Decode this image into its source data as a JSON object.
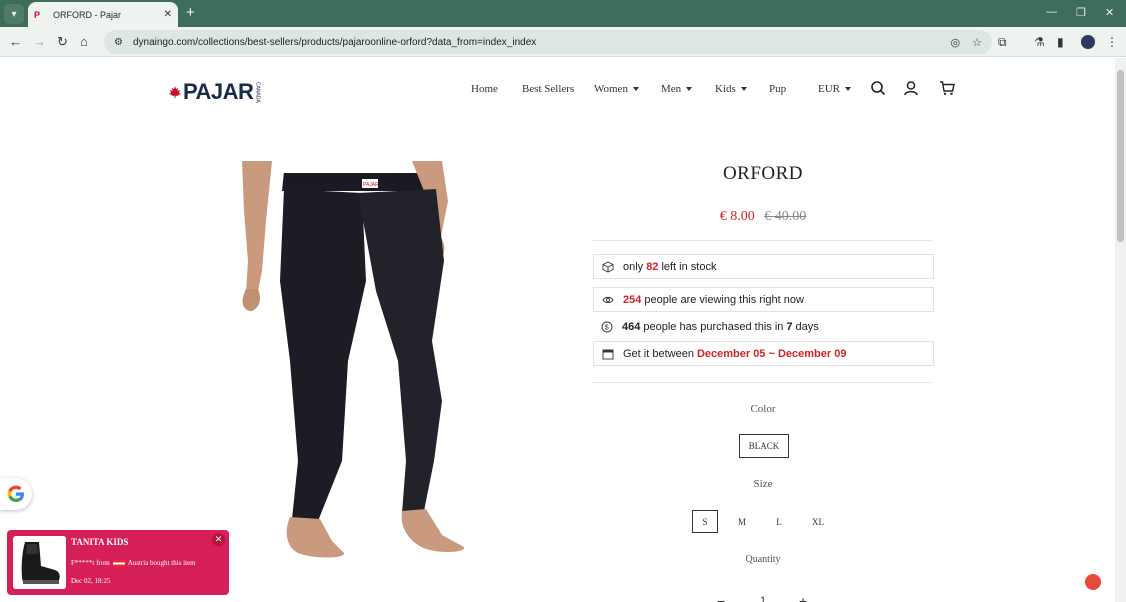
{
  "browser": {
    "tab_title": "ORFORD - Pajar",
    "url": "dynaingo.com/collections/best-sellers/products/pajaroonline-orford?data_from=index_index"
  },
  "header": {
    "logo_text": "PAJAR",
    "logo_sub": "CANADA",
    "nav": [
      {
        "label": "Home"
      },
      {
        "label": "Best Sellers"
      },
      {
        "label": "Women"
      },
      {
        "label": "Men"
      },
      {
        "label": "Kids"
      },
      {
        "label": "Pup"
      }
    ],
    "currency": "EUR"
  },
  "product": {
    "image_logo": "PAJAR",
    "title": "ORFORD",
    "price": "€ 8.00",
    "compare_price": "€ 40.00",
    "stock": {
      "pre": "only",
      "count": "82",
      "post": "left in stock"
    },
    "viewing": {
      "count": "254",
      "post": "people are viewing this right now"
    },
    "purchased": {
      "count": "464",
      "mid": "people has purchased this in",
      "days": "7",
      "post": "days"
    },
    "delivery": {
      "pre": "Get it between",
      "range": "December 05 ~ December 09"
    },
    "color_label": "Color",
    "color_value": "BLACK",
    "size_label": "Size",
    "sizes": [
      "S",
      "M",
      "L",
      "XL"
    ],
    "selected_size": "S",
    "quantity_label": "Quantity",
    "quantity": "1",
    "minus": "−",
    "plus": "+"
  },
  "popup": {
    "title": "TANITA KIDS",
    "buyer": "F*****t from",
    "country_text": "Austria bought this item",
    "time": "Dec 02, 18:25"
  },
  "colors": {
    "chrome": "#3f6d5b",
    "accent_red": "#d0232a",
    "popup": "#d61f57"
  }
}
